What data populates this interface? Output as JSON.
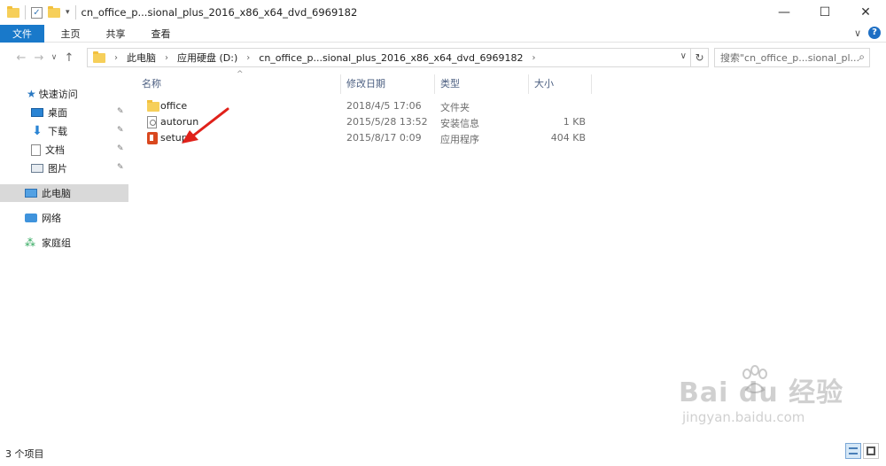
{
  "window": {
    "title": "cn_office_p...sional_plus_2016_x86_x64_dvd_6969182",
    "controls": {
      "minimize": "—",
      "maximize": "☐",
      "close": "✕"
    }
  },
  "ribbon": {
    "tabs": [
      {
        "label": "文件",
        "active": true
      },
      {
        "label": "主页"
      },
      {
        "label": "共享"
      },
      {
        "label": "查看"
      }
    ],
    "expand_glyph": "∨",
    "help_glyph": "?"
  },
  "address": {
    "breadcrumbs": [
      "此电脑",
      "应用硬盘 (D:)",
      "cn_office_p...sional_plus_2016_x86_x64_dvd_6969182"
    ],
    "search_placeholder": "搜索\"cn_office_p...sional_pl..."
  },
  "nav": {
    "quick_access": "快速访问",
    "items": [
      {
        "label": "桌面",
        "icon": "desktop-icon",
        "pinned": true
      },
      {
        "label": "下载",
        "icon": "download-icon",
        "pinned": true
      },
      {
        "label": "文档",
        "icon": "documents-icon",
        "pinned": true
      },
      {
        "label": "图片",
        "icon": "pictures-icon",
        "pinned": true
      }
    ],
    "this_pc": "此电脑",
    "network": "网络",
    "homegroup": "家庭组"
  },
  "columns": {
    "name": "名称",
    "date": "修改日期",
    "type": "类型",
    "size": "大小"
  },
  "files": [
    {
      "name": "office",
      "date": "2018/4/5 17:06",
      "type": "文件夹",
      "size": "",
      "icon": "folder-icon"
    },
    {
      "name": "autorun",
      "date": "2015/5/28 13:52",
      "type": "安装信息",
      "size": "1 KB",
      "icon": "setup-information-icon"
    },
    {
      "name": "setup",
      "date": "2015/8/17 0:09",
      "type": "应用程序",
      "size": "404 KB",
      "icon": "office-app-icon"
    }
  ],
  "status": {
    "item_count": "3 个项目"
  },
  "watermark": {
    "brand": "Bai du 经验",
    "url": "jingyan.baidu.com"
  },
  "colors": {
    "accent": "#1979ca",
    "annotation_arrow": "#e0211a",
    "selected_nav": "#d9d9d9"
  }
}
